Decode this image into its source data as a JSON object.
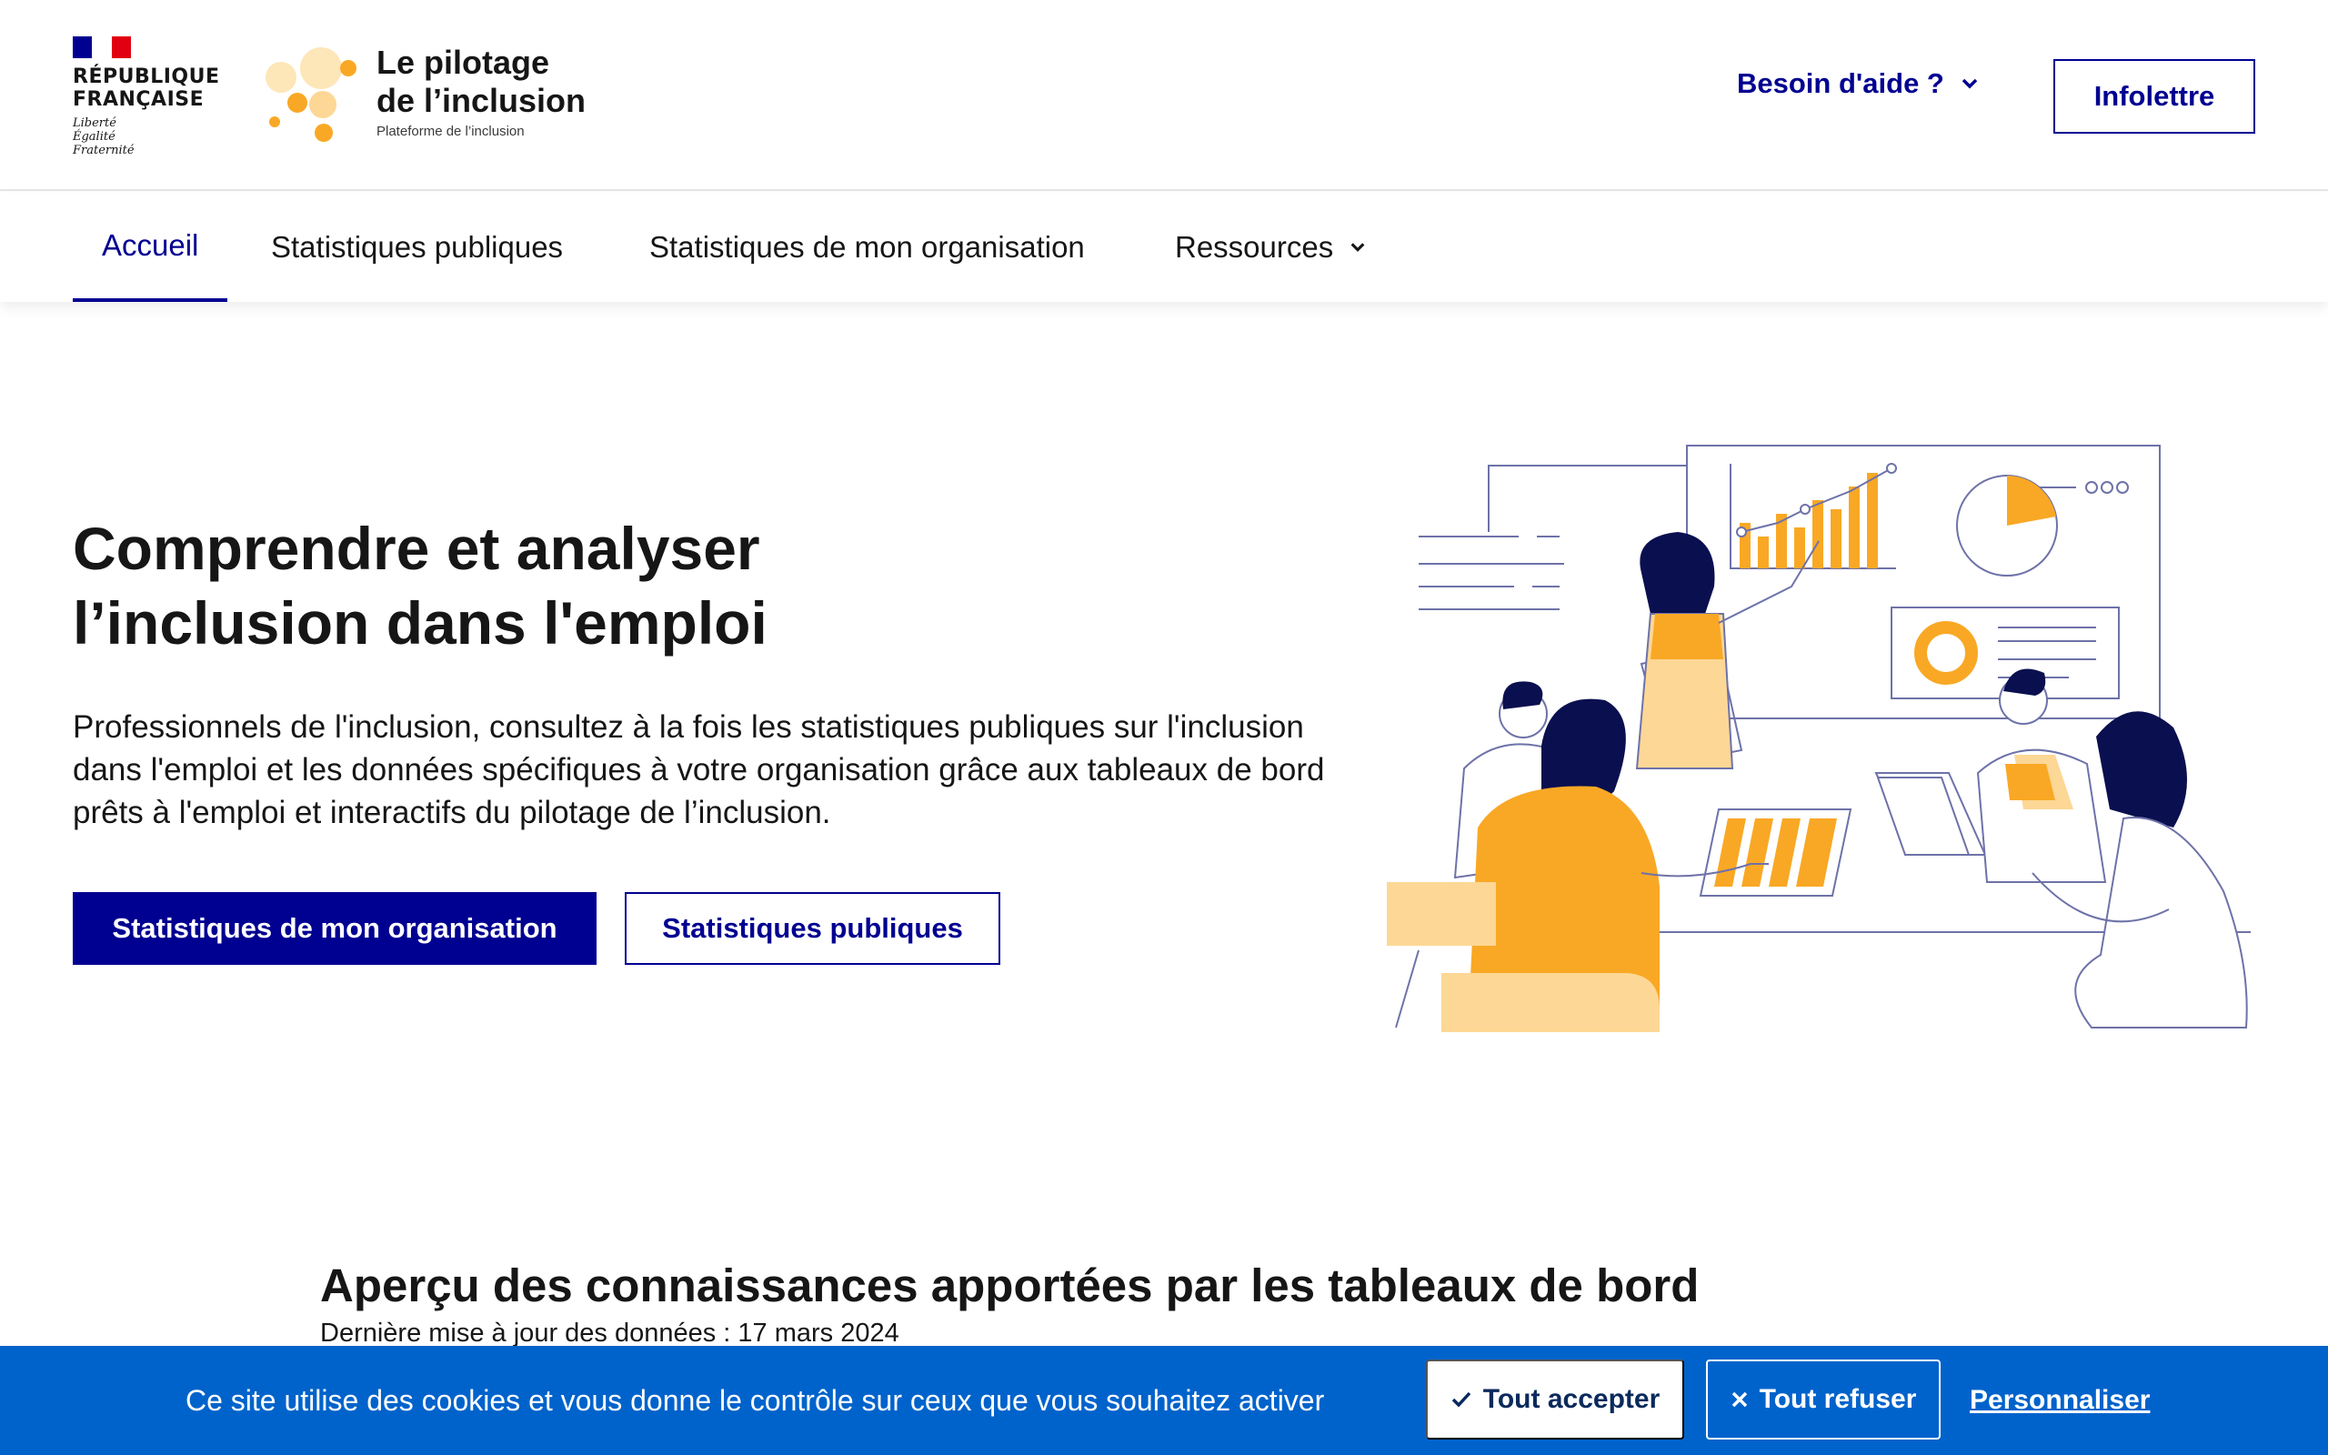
{
  "colors": {
    "primary": "#000091",
    "accent_orange": "#f9a825",
    "accent_light": "#fdd795",
    "cookie_bg": "#0063cb",
    "line": "#6e72a8"
  },
  "header": {
    "gov_logo": {
      "line1": "RÉPUBLIQUE",
      "line2": "FRANÇAISE",
      "devise1": "Liberté",
      "devise2": "Égalité",
      "devise3": "Fraternité"
    },
    "brand": {
      "title_line1": "Le pilotage",
      "title_line2": "de l’inclusion",
      "subtitle": "Plateforme de l’inclusion"
    },
    "help_label": "Besoin d'aide ?",
    "newsletter_label": "Infolettre"
  },
  "nav": {
    "items": [
      {
        "label": "Accueil",
        "active": true
      },
      {
        "label": "Statistiques publiques"
      },
      {
        "label": "Statistiques de mon organisation"
      },
      {
        "label": "Ressources",
        "icon": "chevron-down-icon"
      }
    ]
  },
  "hero": {
    "title_line1": "Comprendre et analyser",
    "title_line2": "l’inclusion dans l'emploi",
    "description": "Professionnels de l'inclusion, consultez à la fois les statistiques publiques sur l'inclusion dans l'emploi et les données spécifiques à votre organisation grâce aux tableaux de bord prêts à l'emploi et interactifs du pilotage de l’inclusion.",
    "primary_button": "Statistiques de mon organisation",
    "secondary_button": "Statistiques publiques"
  },
  "section": {
    "title": "Aperçu des connaissances apportées par les tableaux de bord",
    "updated": "Dernière mise à jour des données : 17 mars 2024"
  },
  "cookie_banner": {
    "text": "Ce site utilise des cookies et vous donne le contrôle sur ceux que vous souhaitez activer",
    "accept_label": "Tout accepter",
    "refuse_label": "Tout refuser",
    "customize_label": "Personnaliser"
  }
}
